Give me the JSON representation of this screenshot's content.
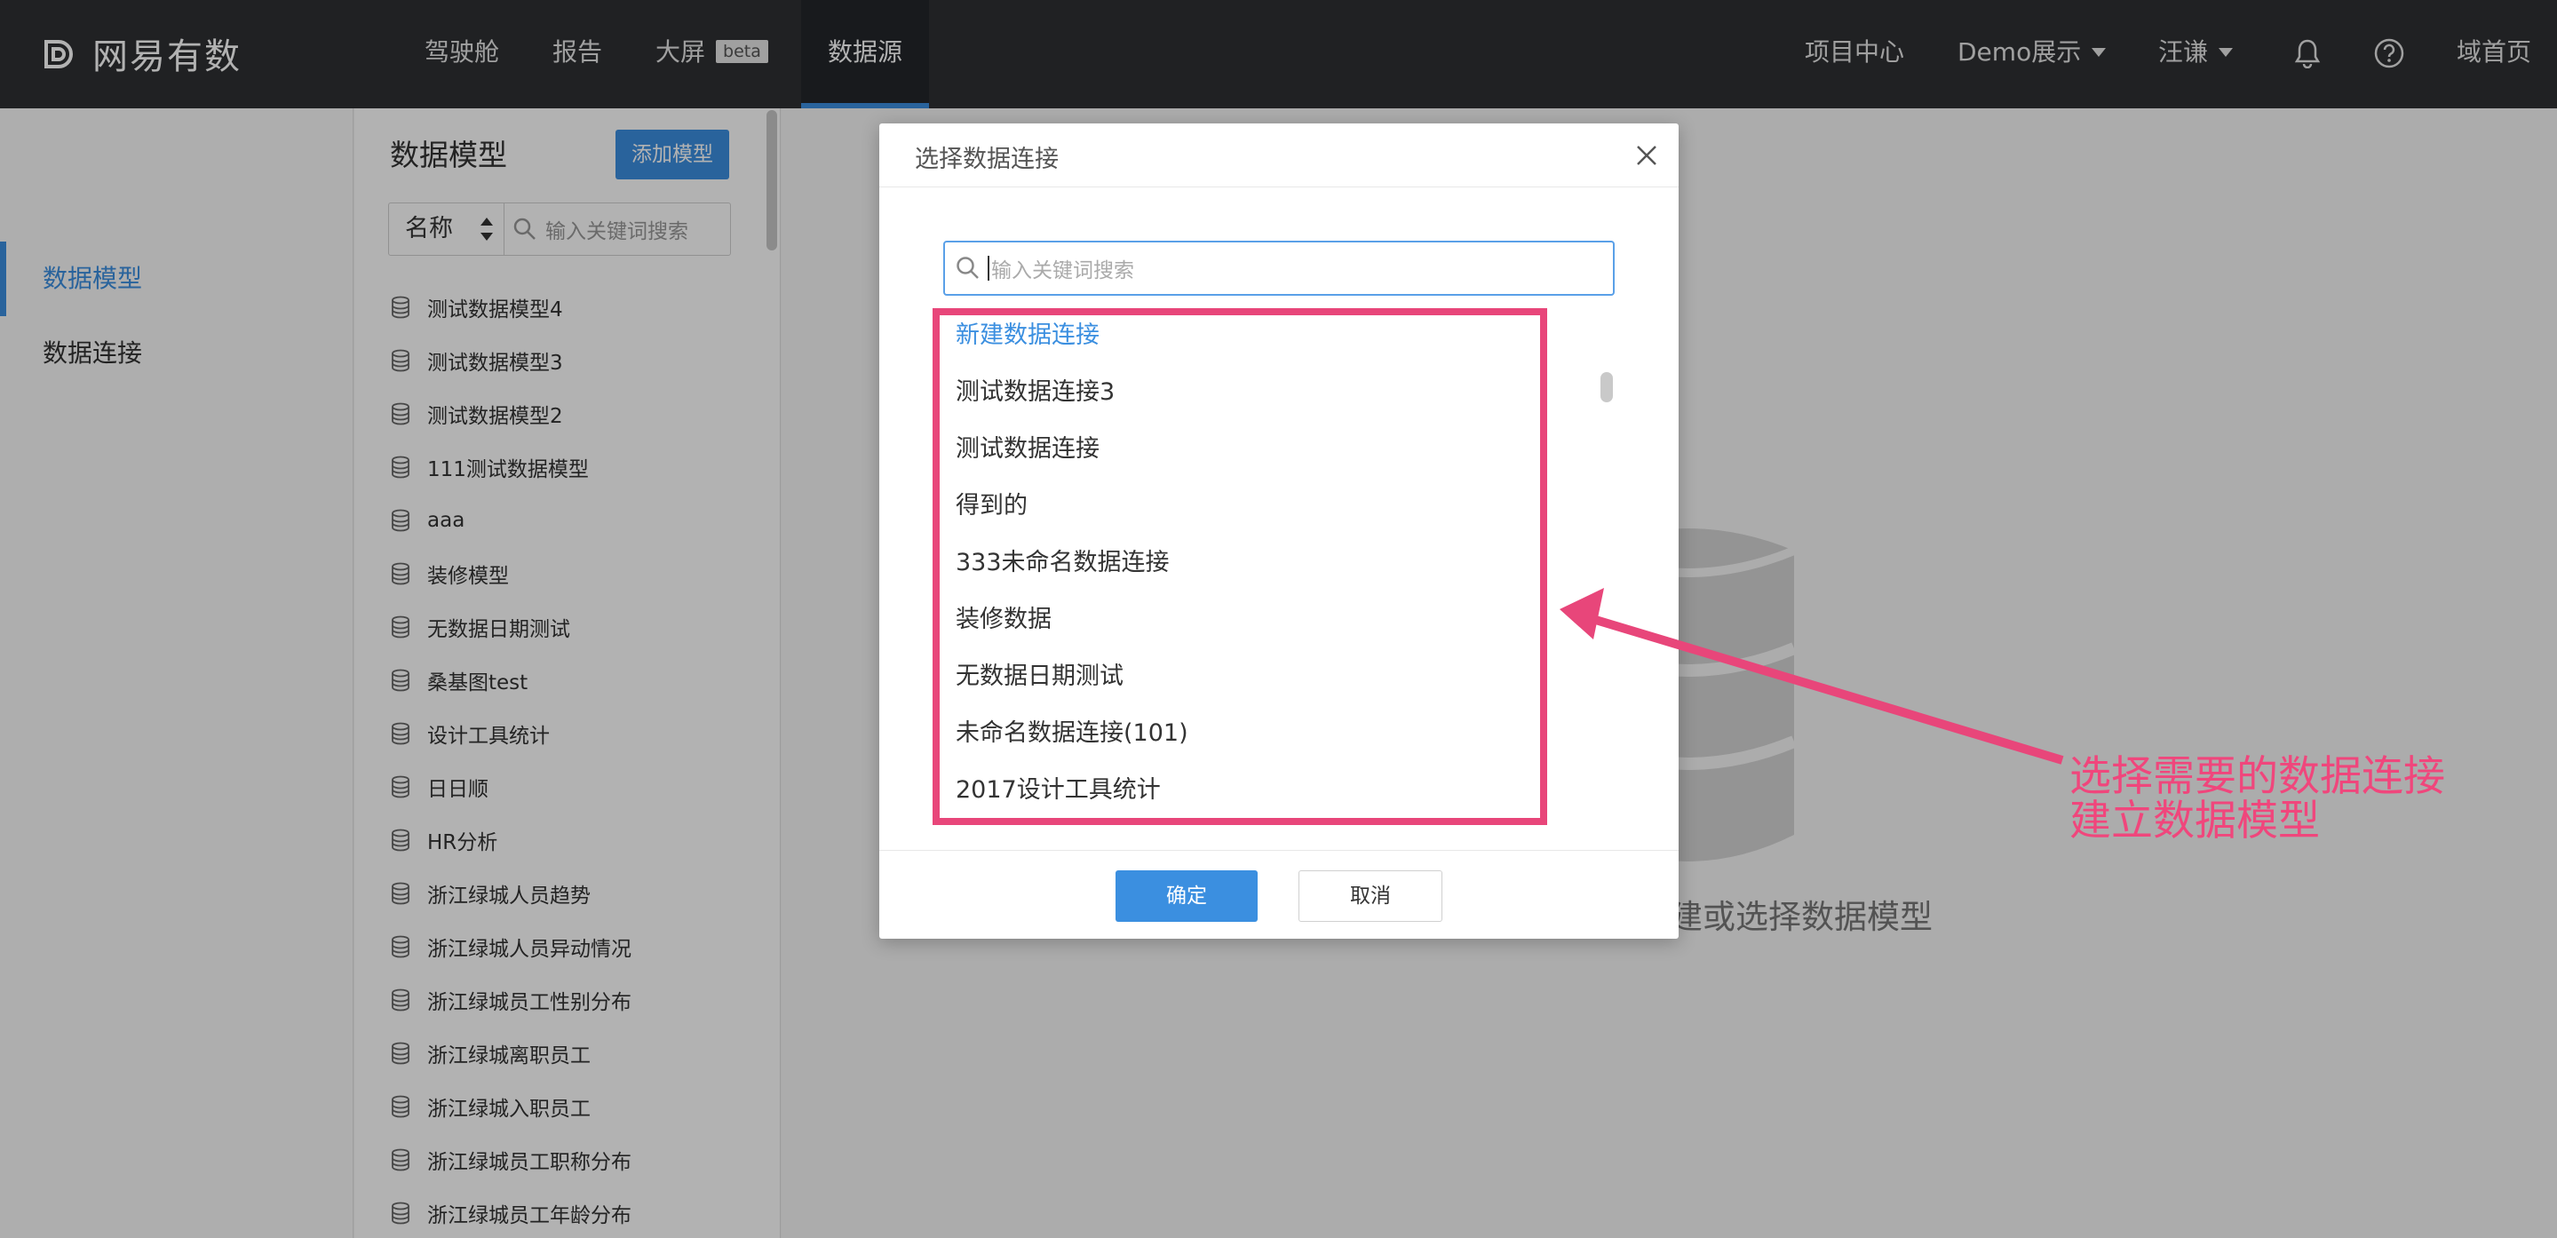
{
  "app": {
    "logo_text": "网易有数"
  },
  "nav": {
    "items": [
      {
        "label": "驾驶舱"
      },
      {
        "label": "报告"
      },
      {
        "label": "大屏",
        "badge": "beta"
      },
      {
        "label": "数据源",
        "active": true
      }
    ],
    "right": {
      "project_center": "项目中心",
      "demo": "Demo展示",
      "user": "汪谦",
      "home": "域首页"
    },
    "icons": [
      "bell-icon",
      "help-icon"
    ]
  },
  "sidebar": {
    "items": [
      {
        "label": "数据模型",
        "active": true
      },
      {
        "label": "数据连接"
      }
    ]
  },
  "model_panel": {
    "title": "数据模型",
    "add_button": "添加模型",
    "filter_select": "名称",
    "search_placeholder": "输入关键词搜索",
    "items": [
      "测试数据模型4",
      "测试数据模型3",
      "测试数据模型2",
      "111测试数据模型",
      "aaa",
      "装修模型",
      "无数据日期测试",
      "桑基图test",
      "设计工具统计",
      "日日顺",
      "HR分析",
      "浙江绿城人员趋势",
      "浙江绿城人员异动情况",
      "浙江绿城员工性别分布",
      "浙江绿城离职员工",
      "浙江绿城入职员工",
      "浙江绿城员工职称分布",
      "浙江绿城员工年龄分布"
    ]
  },
  "main": {
    "empty_text": "建或选择数据模型"
  },
  "modal": {
    "title": "选择数据连接",
    "search_placeholder": "输入关键词搜索",
    "items": [
      {
        "label": "新建数据连接",
        "link": true
      },
      {
        "label": "测试数据连接3"
      },
      {
        "label": "测试数据连接"
      },
      {
        "label": "得到的"
      },
      {
        "label": "333未命名数据连接"
      },
      {
        "label": "装修数据"
      },
      {
        "label": "无数据日期测试"
      },
      {
        "label": "未命名数据连接(101)"
      },
      {
        "label": "2017设计工具统计"
      }
    ],
    "ok": "确定",
    "cancel": "取消"
  },
  "annotation": {
    "line1": "选择需要的数据连接",
    "line2": "建立数据模型",
    "color": "#e8467a"
  },
  "colors": {
    "accent": "#3b8fe0",
    "topbar": "#2e3033"
  }
}
